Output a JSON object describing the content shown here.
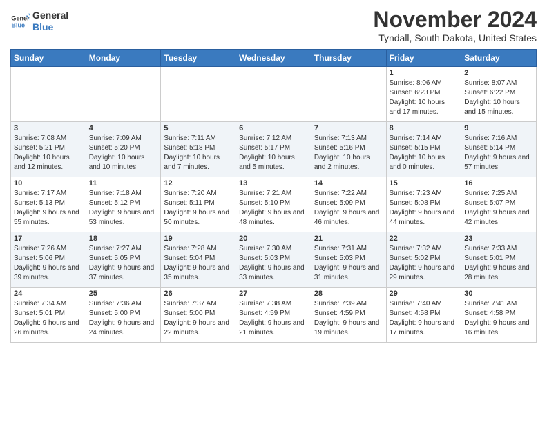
{
  "header": {
    "logo_line1": "General",
    "logo_line2": "Blue",
    "month_title": "November 2024",
    "location": "Tyndall, South Dakota, United States"
  },
  "days_of_week": [
    "Sunday",
    "Monday",
    "Tuesday",
    "Wednesday",
    "Thursday",
    "Friday",
    "Saturday"
  ],
  "weeks": [
    [
      {
        "day": "",
        "info": ""
      },
      {
        "day": "",
        "info": ""
      },
      {
        "day": "",
        "info": ""
      },
      {
        "day": "",
        "info": ""
      },
      {
        "day": "",
        "info": ""
      },
      {
        "day": "1",
        "info": "Sunrise: 8:06 AM\nSunset: 6:23 PM\nDaylight: 10 hours and 17 minutes."
      },
      {
        "day": "2",
        "info": "Sunrise: 8:07 AM\nSunset: 6:22 PM\nDaylight: 10 hours and 15 minutes."
      }
    ],
    [
      {
        "day": "3",
        "info": "Sunrise: 7:08 AM\nSunset: 5:21 PM\nDaylight: 10 hours and 12 minutes."
      },
      {
        "day": "4",
        "info": "Sunrise: 7:09 AM\nSunset: 5:20 PM\nDaylight: 10 hours and 10 minutes."
      },
      {
        "day": "5",
        "info": "Sunrise: 7:11 AM\nSunset: 5:18 PM\nDaylight: 10 hours and 7 minutes."
      },
      {
        "day": "6",
        "info": "Sunrise: 7:12 AM\nSunset: 5:17 PM\nDaylight: 10 hours and 5 minutes."
      },
      {
        "day": "7",
        "info": "Sunrise: 7:13 AM\nSunset: 5:16 PM\nDaylight: 10 hours and 2 minutes."
      },
      {
        "day": "8",
        "info": "Sunrise: 7:14 AM\nSunset: 5:15 PM\nDaylight: 10 hours and 0 minutes."
      },
      {
        "day": "9",
        "info": "Sunrise: 7:16 AM\nSunset: 5:14 PM\nDaylight: 9 hours and 57 minutes."
      }
    ],
    [
      {
        "day": "10",
        "info": "Sunrise: 7:17 AM\nSunset: 5:13 PM\nDaylight: 9 hours and 55 minutes."
      },
      {
        "day": "11",
        "info": "Sunrise: 7:18 AM\nSunset: 5:12 PM\nDaylight: 9 hours and 53 minutes."
      },
      {
        "day": "12",
        "info": "Sunrise: 7:20 AM\nSunset: 5:11 PM\nDaylight: 9 hours and 50 minutes."
      },
      {
        "day": "13",
        "info": "Sunrise: 7:21 AM\nSunset: 5:10 PM\nDaylight: 9 hours and 48 minutes."
      },
      {
        "day": "14",
        "info": "Sunrise: 7:22 AM\nSunset: 5:09 PM\nDaylight: 9 hours and 46 minutes."
      },
      {
        "day": "15",
        "info": "Sunrise: 7:23 AM\nSunset: 5:08 PM\nDaylight: 9 hours and 44 minutes."
      },
      {
        "day": "16",
        "info": "Sunrise: 7:25 AM\nSunset: 5:07 PM\nDaylight: 9 hours and 42 minutes."
      }
    ],
    [
      {
        "day": "17",
        "info": "Sunrise: 7:26 AM\nSunset: 5:06 PM\nDaylight: 9 hours and 39 minutes."
      },
      {
        "day": "18",
        "info": "Sunrise: 7:27 AM\nSunset: 5:05 PM\nDaylight: 9 hours and 37 minutes."
      },
      {
        "day": "19",
        "info": "Sunrise: 7:28 AM\nSunset: 5:04 PM\nDaylight: 9 hours and 35 minutes."
      },
      {
        "day": "20",
        "info": "Sunrise: 7:30 AM\nSunset: 5:03 PM\nDaylight: 9 hours and 33 minutes."
      },
      {
        "day": "21",
        "info": "Sunrise: 7:31 AM\nSunset: 5:03 PM\nDaylight: 9 hours and 31 minutes."
      },
      {
        "day": "22",
        "info": "Sunrise: 7:32 AM\nSunset: 5:02 PM\nDaylight: 9 hours and 29 minutes."
      },
      {
        "day": "23",
        "info": "Sunrise: 7:33 AM\nSunset: 5:01 PM\nDaylight: 9 hours and 28 minutes."
      }
    ],
    [
      {
        "day": "24",
        "info": "Sunrise: 7:34 AM\nSunset: 5:01 PM\nDaylight: 9 hours and 26 minutes."
      },
      {
        "day": "25",
        "info": "Sunrise: 7:36 AM\nSunset: 5:00 PM\nDaylight: 9 hours and 24 minutes."
      },
      {
        "day": "26",
        "info": "Sunrise: 7:37 AM\nSunset: 5:00 PM\nDaylight: 9 hours and 22 minutes."
      },
      {
        "day": "27",
        "info": "Sunrise: 7:38 AM\nSunset: 4:59 PM\nDaylight: 9 hours and 21 minutes."
      },
      {
        "day": "28",
        "info": "Sunrise: 7:39 AM\nSunset: 4:59 PM\nDaylight: 9 hours and 19 minutes."
      },
      {
        "day": "29",
        "info": "Sunrise: 7:40 AM\nSunset: 4:58 PM\nDaylight: 9 hours and 17 minutes."
      },
      {
        "day": "30",
        "info": "Sunrise: 7:41 AM\nSunset: 4:58 PM\nDaylight: 9 hours and 16 minutes."
      }
    ]
  ]
}
